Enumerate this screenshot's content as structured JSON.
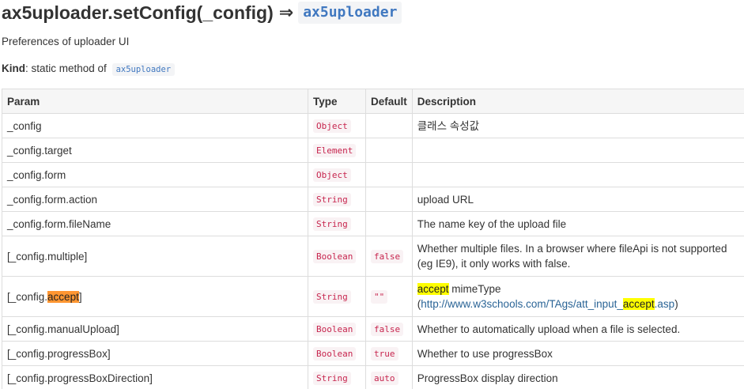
{
  "heading": {
    "signature": "ax5uploader.setConfig(_config)",
    "arrow": "⇒",
    "return_type": "ax5uploader"
  },
  "description": "Preferences of uploader UI",
  "kind": {
    "label": "Kind",
    "text": ": static method of",
    "code": "ax5uploader"
  },
  "table": {
    "headers": [
      "Param",
      "Type",
      "Default",
      "Description"
    ],
    "rows": [
      {
        "param": "_config",
        "type": "Object",
        "default": "",
        "description": "클래스 속성값"
      },
      {
        "param": "_config.target",
        "type": "Element",
        "default": "",
        "description": ""
      },
      {
        "param": "_config.form",
        "type": "Object",
        "default": "",
        "description": ""
      },
      {
        "param": "_config.form.action",
        "type": "String",
        "default": "",
        "description": "upload URL"
      },
      {
        "param": "_config.form.fileName",
        "type": "String",
        "default": "",
        "description": "The name key of the upload file"
      },
      {
        "param": "[_config.multiple]",
        "type": "Boolean",
        "default": "false",
        "description": "Whether multiple files. In a browser where fileApi is not supported (eg IE9), it only works with false."
      },
      {
        "param_prefix": "[_config.",
        "param_highlight": "accept",
        "param_suffix": "]",
        "type": "String",
        "default": "\"\"",
        "desc_highlight": "accept",
        "desc_text": " mimeType",
        "desc_paren_open": "(",
        "desc_link_prefix": "http://www.w3schools.com/TAgs/att_input_",
        "desc_link_highlight": "accept",
        "desc_link_suffix": ".asp",
        "desc_paren_close": ")"
      },
      {
        "param": "[_config.manualUpload]",
        "type": "Boolean",
        "default": "false",
        "description": "Whether to automatically upload when a file is selected."
      },
      {
        "param": "[_config.progressBox]",
        "type": "Boolean",
        "default": "true",
        "description": "Whether to use progressBox"
      },
      {
        "param": "[_config.progressBoxDirection]",
        "type": "String",
        "default": "auto",
        "description": "ProgressBox display direction"
      }
    ]
  }
}
